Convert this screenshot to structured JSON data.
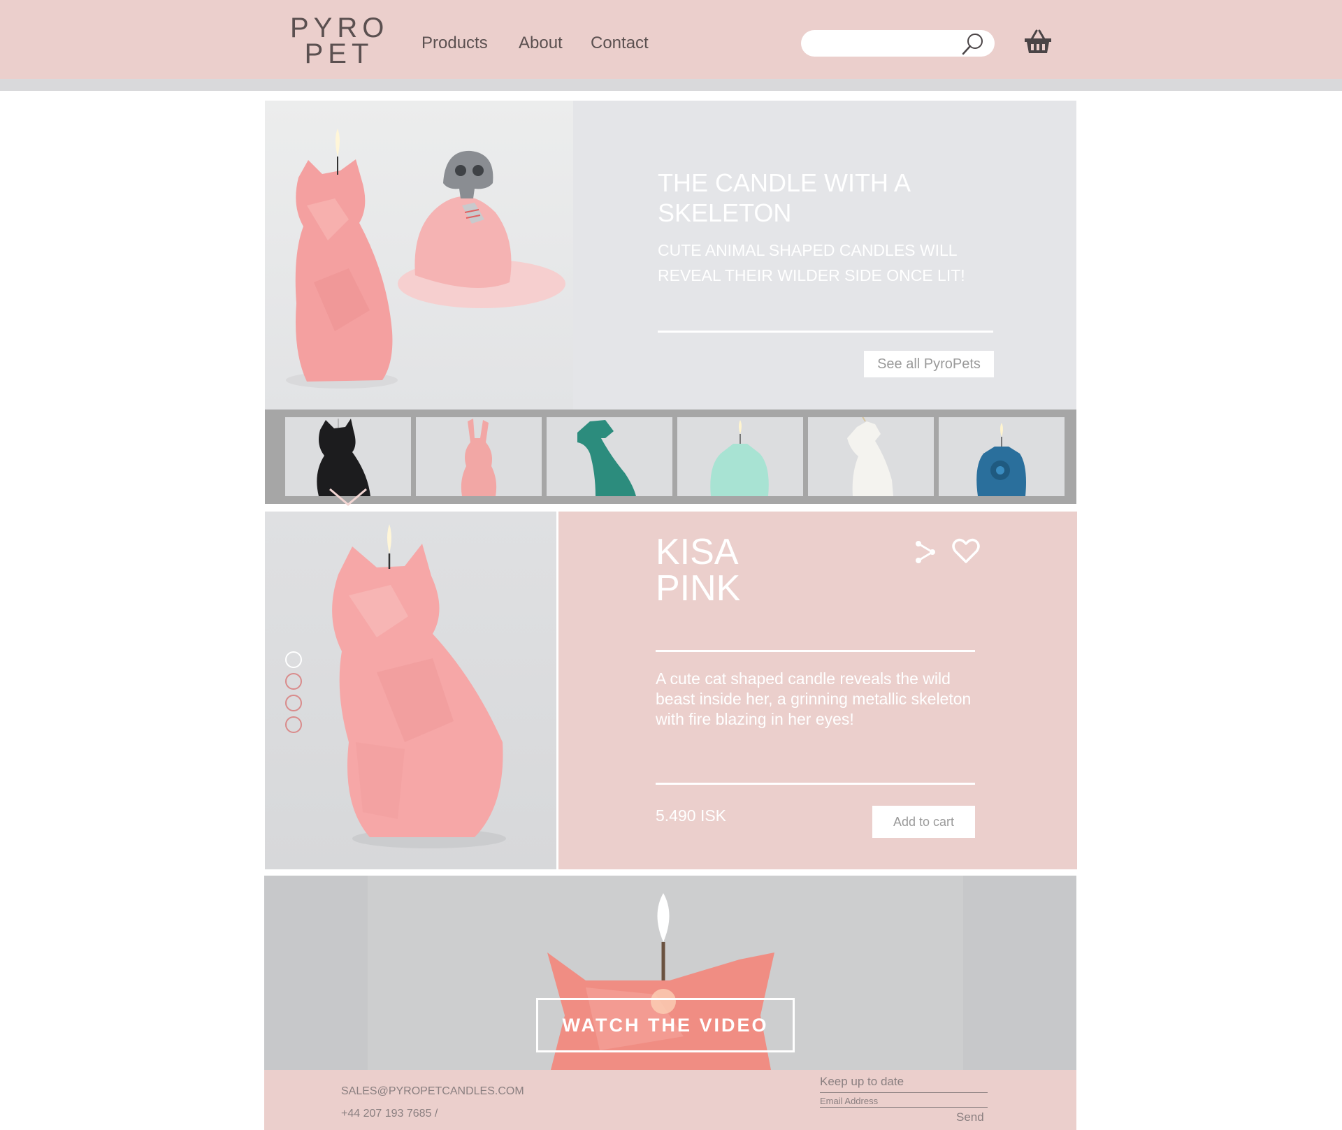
{
  "colors": {
    "header_bg": "#ebcfcc",
    "hero_bg": "#e4e5e8",
    "text_dark": "#5b5050",
    "accent_pink": "#d98b8b"
  },
  "header": {
    "logo_line1": "PYRO",
    "logo_line2": "PET",
    "nav": [
      "Products",
      "About",
      "Contact"
    ],
    "search_value": "",
    "icons": [
      "search-icon",
      "basket-icon"
    ]
  },
  "hero": {
    "title": "THE CANDLE WITH A SKELETON",
    "subtitle": "CUTE ANIMAL SHAPED CANDLES WILL REVEAL THEIR WILDER SIDE ONCE LIT!",
    "button": "See all PyroPets"
  },
  "thumbnails": [
    {
      "name": "black-cat",
      "color": "#1c1c1e"
    },
    {
      "name": "pink-rabbit",
      "color": "#f2a7a5"
    },
    {
      "name": "teal-dinosaur",
      "color": "#2c8c7d"
    },
    {
      "name": "mint-candle",
      "color": "#a8e3d3"
    },
    {
      "name": "white-unicorn",
      "color": "#f4f3ef"
    },
    {
      "name": "blue-candle",
      "color": "#2a6f9c"
    }
  ],
  "product": {
    "name_line1": "KISA",
    "name_line2": "PINK",
    "description": "A cute cat shaped candle reveals the wild beast inside her, a grinning metallic skeleton with fire blazing in her eyes!",
    "price": "5.490 ISK",
    "add_to_cart": "Add to cart",
    "gallery_dots": 4
  },
  "video": {
    "button": "WATCH THE VIDEO"
  },
  "footer": {
    "email": "SALES@PYROPETCANDLES.COM",
    "phone": "+44 207 193 7685 /",
    "newsletter_title": "Keep up to date",
    "email_placeholder": "Email Address",
    "send": "Send"
  }
}
